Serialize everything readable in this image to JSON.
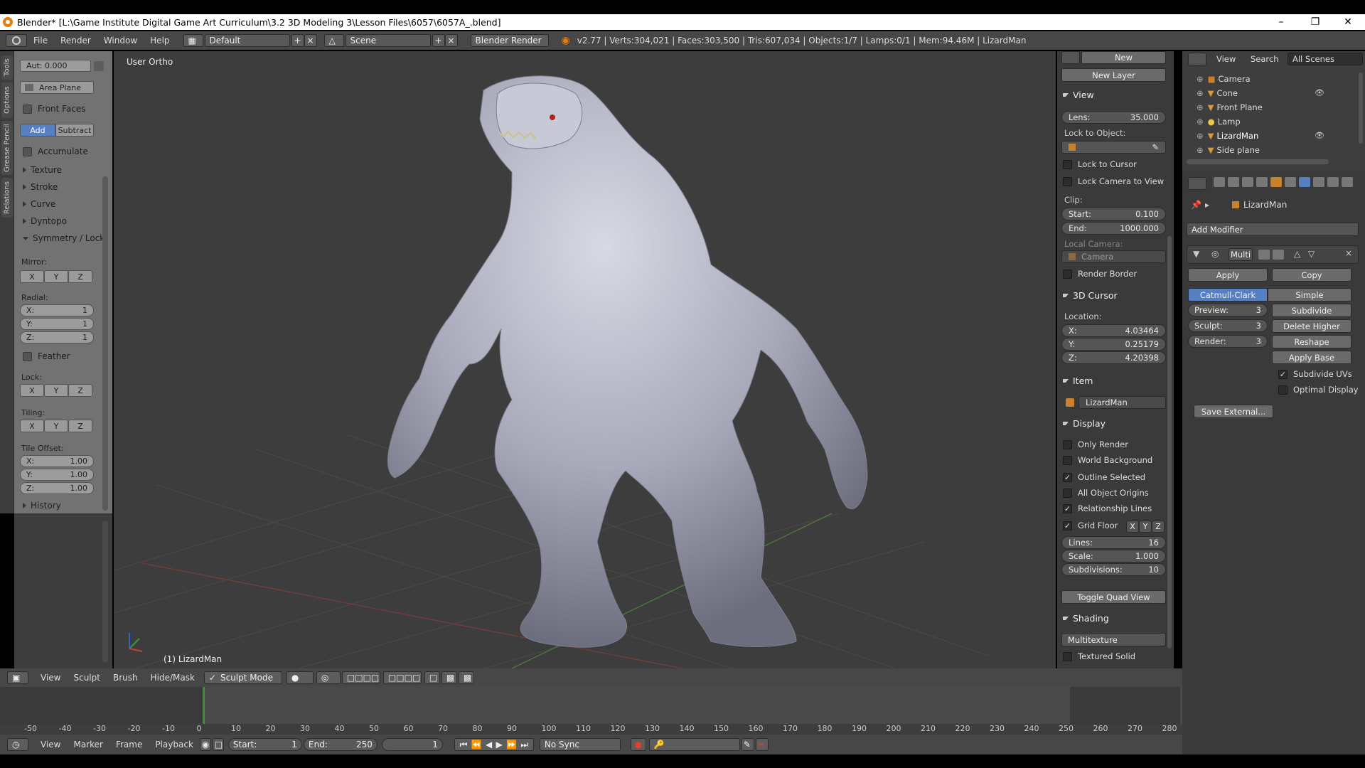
{
  "window": {
    "title": "Blender* [L:\\Game Institute Digital Game Art  Curriculum\\3.2 3D Modeling 3\\Lesson Files\\6057\\6057A_.blend]",
    "minimize_glyph": "–",
    "maximize_glyph": "❐",
    "close_glyph": "✕"
  },
  "infobar": {
    "menus": [
      "File",
      "Render",
      "Window",
      "Help"
    ],
    "layout": "Default",
    "scene": "Scene",
    "engine": "Blender Render",
    "stats": "v2.77 | Verts:304,021 | Faces:303,500 | Tris:607,034 | Objects:1/7 | Lamps:0/1 | Mem:94.46M | LizardMan"
  },
  "left_tabs": [
    "Tools",
    "Options",
    "Grease Pencil",
    "Relations"
  ],
  "toolshelf": {
    "autosmooth": "Aut: 0.000",
    "area_plane": "Area Plane",
    "front_faces": "Front Faces",
    "add": "Add",
    "subtract": "Subtract",
    "accumulate": "Accumulate",
    "panels": [
      "Texture",
      "Stroke",
      "Curve",
      "Dyntopo"
    ],
    "symmetry_header": "Symmetry / Lock",
    "mirror_label": "Mirror:",
    "axes": [
      "X",
      "Y",
      "Z"
    ],
    "radial_label": "Radial:",
    "radial": [
      {
        "axis": "X:",
        "value": "1"
      },
      {
        "axis": "Y:",
        "value": "1"
      },
      {
        "axis": "Z:",
        "value": "1"
      }
    ],
    "feather": "Feather",
    "lock_label": "Lock:",
    "tiling_label": "Tiling:",
    "tile_offset_label": "Tile Offset:",
    "tile_offset": [
      {
        "axis": "X:",
        "value": "1.00"
      },
      {
        "axis": "Y:",
        "value": "1.00"
      },
      {
        "axis": "Z:",
        "value": "1.00"
      }
    ],
    "history": "History"
  },
  "viewport": {
    "view_name": "User Ortho",
    "object_label": "(1) LizardMan"
  },
  "npanel": {
    "new": "New",
    "new_layer": "New Layer",
    "view_header": "View",
    "lens_label": "Lens:",
    "lens_value": "35.000",
    "lock_to_object": "Lock to Object:",
    "lock_to_cursor": "Lock to Cursor",
    "lock_camera_to_view": "Lock Camera to View",
    "clip_label": "Clip:",
    "clip_start_label": "Start:",
    "clip_start": "0.100",
    "clip_end_label": "End:",
    "clip_end": "1000.000",
    "local_camera": "Local Camera:",
    "camera": "Camera",
    "render_border": "Render Border",
    "cursor_header": "3D Cursor",
    "location_label": "Location:",
    "cursor": [
      {
        "axis": "X:",
        "value": "4.03464"
      },
      {
        "axis": "Y:",
        "value": "0.25179"
      },
      {
        "axis": "Z:",
        "value": "4.20398"
      }
    ],
    "item_header": "Item",
    "item_name": "LizardMan",
    "display_header": "Display",
    "display_options": [
      {
        "label": "Only Render",
        "checked": false
      },
      {
        "label": "World Background",
        "checked": false
      },
      {
        "label": "Outline Selected",
        "checked": true
      },
      {
        "label": "All Object Origins",
        "checked": false
      },
      {
        "label": "Relationship Lines",
        "checked": true
      }
    ],
    "grid_floor": "Grid Floor",
    "grid_axes": [
      "X",
      "Y",
      "Z"
    ],
    "lines_label": "Lines:",
    "lines_value": "16",
    "scale_label": "Scale:",
    "scale_value": "1.000",
    "subdiv_label": "Subdivisions:",
    "subdiv_value": "10",
    "toggle_quad": "Toggle Quad View",
    "shading_header": "Shading",
    "shading_mode": "Multitexture",
    "textured_solid": "Textured Solid"
  },
  "outliner": {
    "view": "View",
    "search": "Search",
    "scenes": "All Scenes",
    "items": [
      "Camera",
      "Cone",
      "Front Plane",
      "Lamp",
      "LizardMan",
      "Side plane"
    ]
  },
  "properties": {
    "object_name": "LizardMan",
    "add_modifier": "Add Modifier",
    "modifier_name": "Multi",
    "apply": "Apply",
    "copy": "Copy",
    "catmull": "Catmull-Clark",
    "simple": "Simple",
    "preview_label": "Preview:",
    "preview_value": "3",
    "sculpt_label": "Sculpt:",
    "sculpt_value": "3",
    "render_label": "Render:",
    "render_value": "3",
    "subdivide": "Subdivide",
    "delete_higher": "Delete Higher",
    "reshape": "Reshape",
    "apply_base": "Apply Base",
    "subdivide_uvs": "Subdivide UVs",
    "optimal_display": "Optimal Display",
    "save_external": "Save External..."
  },
  "view_header": {
    "menus": [
      "View",
      "Sculpt",
      "Brush",
      "Hide/Mask"
    ],
    "mode": "Sculpt Mode"
  },
  "timeline": {
    "ticks": [
      "-50",
      "-40",
      "-30",
      "-20",
      "-10",
      "0",
      "10",
      "20",
      "30",
      "40",
      "50",
      "60",
      "70",
      "80",
      "90",
      "100",
      "110",
      "120",
      "130",
      "140",
      "150",
      "160",
      "170",
      "180",
      "190",
      "200",
      "210",
      "220",
      "230",
      "240",
      "250",
      "260",
      "270",
      "280"
    ],
    "current_frame": 1,
    "menus": [
      "View",
      "Marker",
      "Frame",
      "Playback"
    ],
    "start_label": "Start:",
    "start": "1",
    "end_label": "End:",
    "end": "250",
    "frame": "1",
    "sync": "No Sync"
  }
}
